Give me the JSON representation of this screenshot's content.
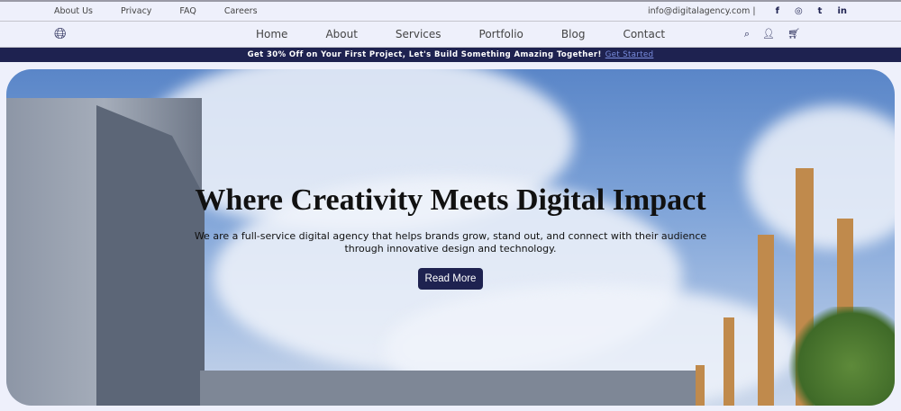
{
  "topbar": {
    "links": [
      "About Us",
      "Privacy",
      "FAQ",
      "Careers"
    ],
    "email": "info@digitalagency.com |",
    "social": [
      "facebook-icon",
      "instagram-icon",
      "twitter-icon",
      "linkedin-icon"
    ]
  },
  "nav": {
    "links": [
      "Home",
      "About",
      "Services",
      "Portfolio",
      "Blog",
      "Contact"
    ]
  },
  "promo": {
    "text": "Get 30% Off on Your First Project, Let's Build Something Amazing Together!",
    "link": "Get Started"
  },
  "hero": {
    "title": "Where Creativity Meets Digital Impact",
    "subtitle": "We are a full-service digital agency that helps brands grow, stand out, and connect with their audience through innovative design and technology.",
    "button": "Read More"
  },
  "colors": {
    "brand": "#1e2250",
    "background": "#eef0fb"
  }
}
